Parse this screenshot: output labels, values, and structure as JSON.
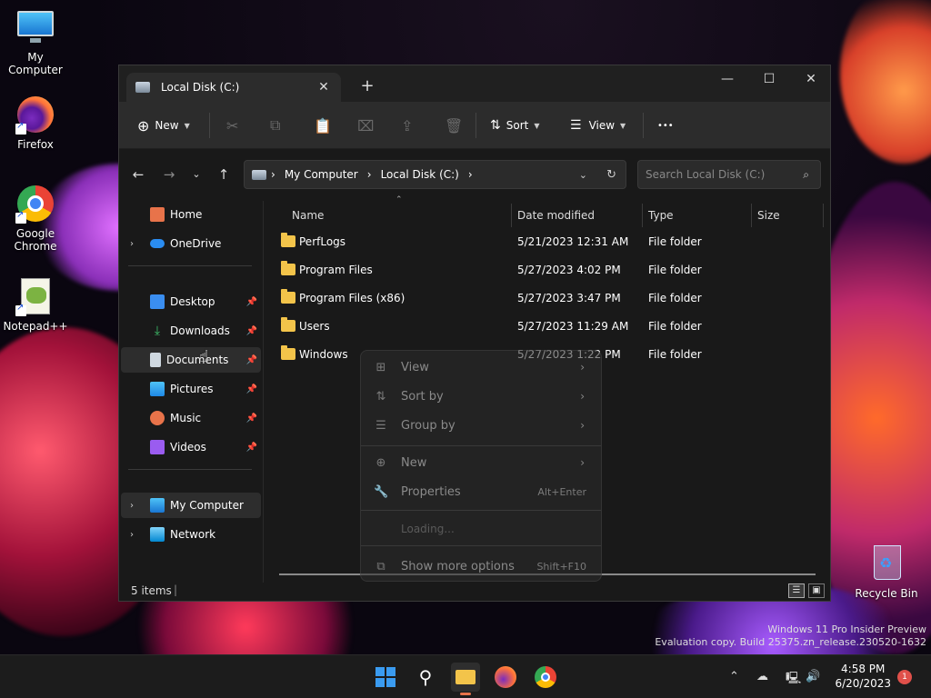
{
  "desktop": {
    "icons": [
      {
        "label": "My Computer"
      },
      {
        "label": "Firefox"
      },
      {
        "label": "Google Chrome"
      },
      {
        "label": "Notepad++"
      },
      {
        "label": "Recycle Bin"
      }
    ],
    "watermark_line1": "Windows 11 Pro Insider Preview",
    "watermark_line2": "Evaluation copy. Build 25375.zn_release.230520-1632"
  },
  "window": {
    "tab_title": "Local Disk (C:)",
    "newtab_label": "+",
    "close_tab": "✕"
  },
  "toolbar": {
    "new_label": "New",
    "sort_label": "Sort",
    "view_label": "View",
    "more_label": "•••"
  },
  "address": {
    "crumbs": [
      "My Computer",
      "Local Disk (C:)"
    ],
    "search_placeholder": "Search Local Disk (C:)"
  },
  "nav": {
    "items": [
      {
        "label": "Home"
      },
      {
        "label": "OneDrive"
      },
      {
        "label": "Desktop"
      },
      {
        "label": "Downloads"
      },
      {
        "label": "Documents"
      },
      {
        "label": "Pictures"
      },
      {
        "label": "Music"
      },
      {
        "label": "Videos"
      },
      {
        "label": "My Computer"
      },
      {
        "label": "Network"
      }
    ]
  },
  "columns": {
    "name": "Name",
    "date": "Date modified",
    "type": "Type",
    "size": "Size"
  },
  "files": [
    {
      "name": "PerfLogs",
      "date": "5/21/2023 12:31 AM",
      "type": "File folder"
    },
    {
      "name": "Program Files",
      "date": "5/27/2023 4:02 PM",
      "type": "File folder"
    },
    {
      "name": "Program Files (x86)",
      "date": "5/27/2023 3:47 PM",
      "type": "File folder"
    },
    {
      "name": "Users",
      "date": "5/27/2023 11:29 AM",
      "type": "File folder"
    },
    {
      "name": "Windows",
      "date": "5/27/2023 1:22 PM",
      "type": "File folder"
    }
  ],
  "status": {
    "items": "5 items"
  },
  "context_menu": {
    "view": "View",
    "sort_by": "Sort by",
    "group_by": "Group by",
    "new": "New",
    "properties": "Properties",
    "properties_shortcut": "Alt+Enter",
    "loading": "Loading...",
    "more_options": "Show more options",
    "more_options_shortcut": "Shift+F10"
  },
  "taskbar": {
    "time": "4:58 PM",
    "date": "6/20/2023",
    "notifications": "1"
  }
}
